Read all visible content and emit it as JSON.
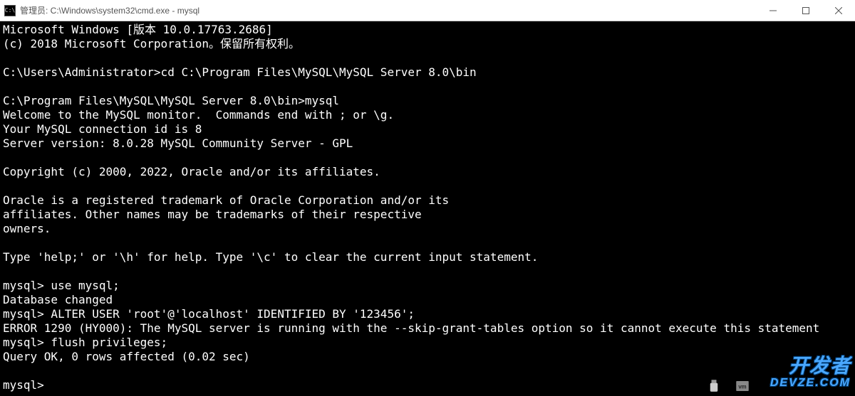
{
  "window": {
    "icon_label": "C:\\",
    "title": "管理员: C:\\Windows\\system32\\cmd.exe - mysql"
  },
  "terminal": {
    "lines": [
      "Microsoft Windows [版本 10.0.17763.2686]",
      "(c) 2018 Microsoft Corporation。保留所有权利。",
      "",
      "C:\\Users\\Administrator>cd C:\\Program Files\\MySQL\\MySQL Server 8.0\\bin",
      "",
      "C:\\Program Files\\MySQL\\MySQL Server 8.0\\bin>mysql",
      "Welcome to the MySQL monitor.  Commands end with ; or \\g.",
      "Your MySQL connection id is 8",
      "Server version: 8.0.28 MySQL Community Server - GPL",
      "",
      "Copyright (c) 2000, 2022, Oracle and/or its affiliates.",
      "",
      "Oracle is a registered trademark of Oracle Corporation and/or its",
      "affiliates. Other names may be trademarks of their respective",
      "owners.",
      "",
      "Type 'help;' or '\\h' for help. Type '\\c' to clear the current input statement.",
      "",
      "mysql> use mysql;",
      "Database changed",
      "mysql> ALTER USER 'root'@'localhost' IDENTIFIED BY '123456';",
      "ERROR 1290 (HY000): The MySQL server is running with the --skip-grant-tables option so it cannot execute this statement",
      "mysql> flush privileges;",
      "Query OK, 0 rows affected (0.02 sec)",
      "",
      "mysql>"
    ]
  },
  "watermark": {
    "line1": "开发者",
    "line2": "DEVZE.COM"
  }
}
